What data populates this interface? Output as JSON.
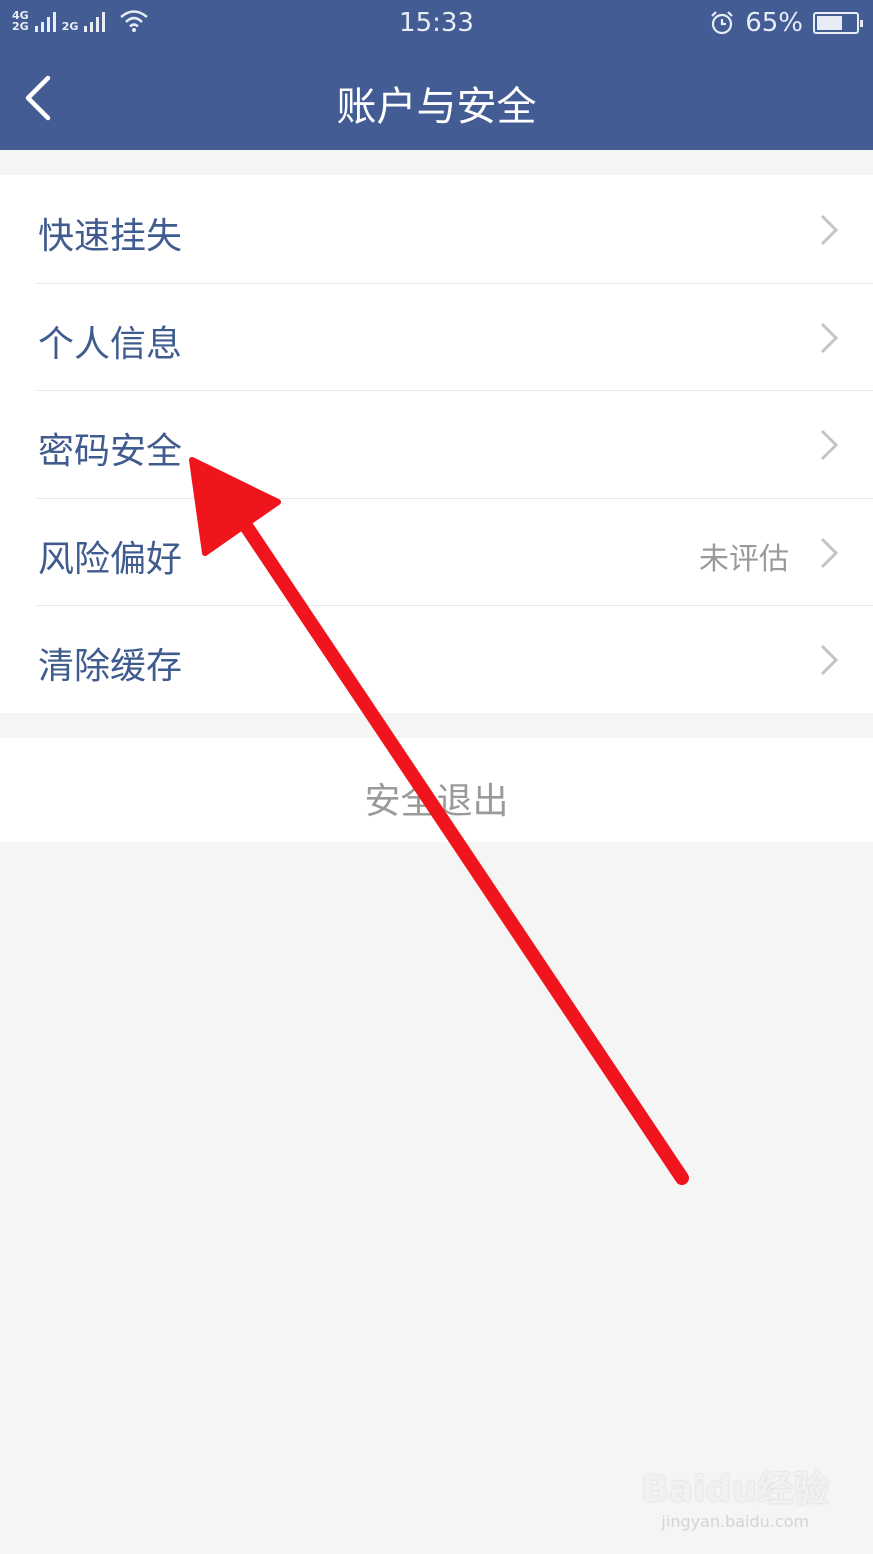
{
  "status_bar": {
    "network_top": "4G",
    "network_bottom": "2G",
    "network2": "2G",
    "time": "15:33",
    "battery_text": "65%",
    "battery_level": 0.65
  },
  "nav": {
    "title": "账户与安全"
  },
  "menu": {
    "items": [
      {
        "label": "快速挂失",
        "value": ""
      },
      {
        "label": "个人信息",
        "value": ""
      },
      {
        "label": "密码安全",
        "value": ""
      },
      {
        "label": "风险偏好",
        "value": "未评估"
      },
      {
        "label": "清除缓存",
        "value": ""
      }
    ]
  },
  "logout": {
    "label": "安全退出"
  },
  "watermark": {
    "logo": "Baidu经验",
    "url": "jingyan.baidu.com"
  },
  "colors": {
    "header": "#435d94",
    "item_text": "#405c8f",
    "annotation_arrow": "#f0141c"
  }
}
